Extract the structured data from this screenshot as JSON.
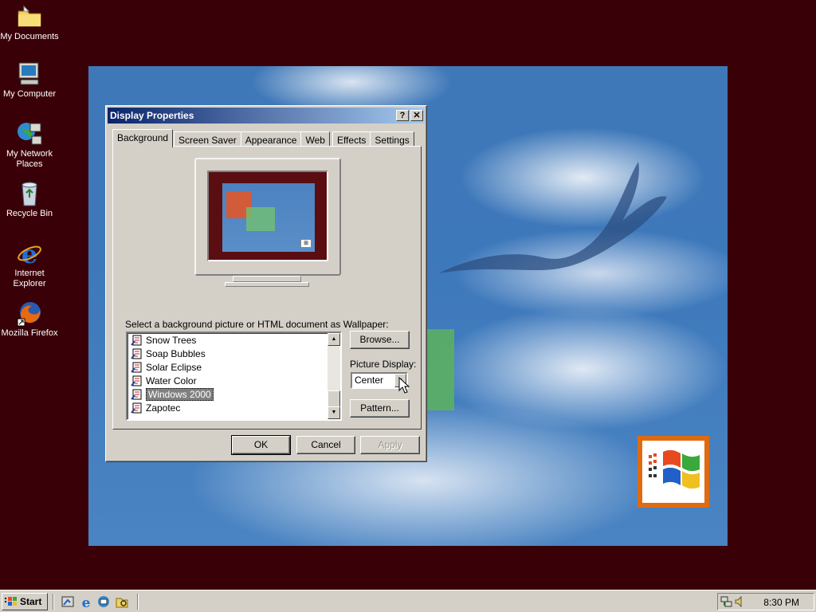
{
  "desktop": {
    "icons": [
      {
        "label": "My Documents"
      },
      {
        "label": "My Computer"
      },
      {
        "label": "My Network Places"
      },
      {
        "label": "Recycle Bin"
      },
      {
        "label": "Internet Explorer"
      },
      {
        "label": "Mozilla Firefox"
      }
    ]
  },
  "dialog": {
    "title": "Display Properties",
    "help_button": "?",
    "close_button": "✕",
    "tabs": [
      "Background",
      "Screen Saver",
      "Appearance",
      "Web",
      "Effects",
      "Settings"
    ],
    "active_tab": "Background",
    "wallpaper_prompt": "Select a background picture or HTML document as Wallpaper:",
    "wallpapers": [
      {
        "label": "Snow Trees"
      },
      {
        "label": "Soap Bubbles"
      },
      {
        "label": "Solar Eclipse"
      },
      {
        "label": "Water Color"
      },
      {
        "label": "Windows 2000",
        "selected": true
      },
      {
        "label": "Zapotec"
      }
    ],
    "browse_button": "Browse...",
    "picture_display_label": "Picture Display:",
    "picture_display_value": "Center",
    "pattern_button": "Pattern...",
    "ok_button": "OK",
    "cancel_button": "Cancel",
    "apply_button": "Apply"
  },
  "taskbar": {
    "start_label": "Start",
    "clock": "8:30 PM"
  },
  "colors": {
    "desktop_bg": "#3a0008",
    "title_active": "#0a246a",
    "face": "#d4d0c8",
    "wallpaper_blue": "#3f78b8"
  }
}
